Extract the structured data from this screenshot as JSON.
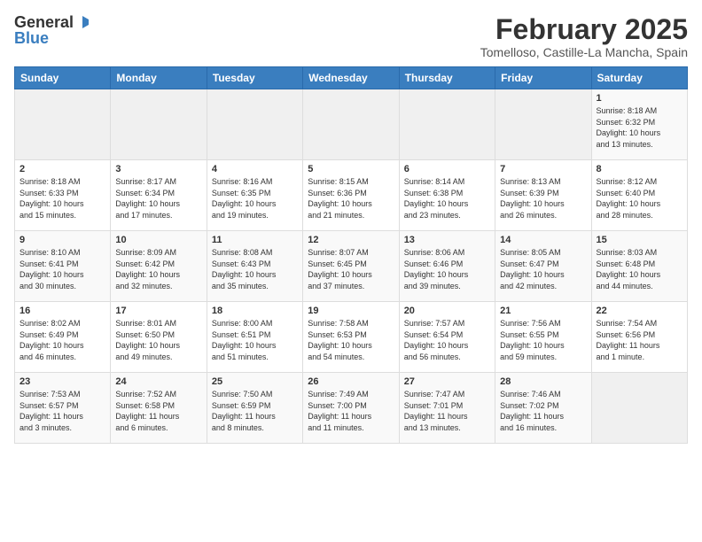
{
  "header": {
    "logo_general": "General",
    "logo_blue": "Blue",
    "month_title": "February 2025",
    "location": "Tomelloso, Castille-La Mancha, Spain"
  },
  "weekdays": [
    "Sunday",
    "Monday",
    "Tuesday",
    "Wednesday",
    "Thursday",
    "Friday",
    "Saturday"
  ],
  "weeks": [
    [
      {
        "day": "",
        "info": ""
      },
      {
        "day": "",
        "info": ""
      },
      {
        "day": "",
        "info": ""
      },
      {
        "day": "",
        "info": ""
      },
      {
        "day": "",
        "info": ""
      },
      {
        "day": "",
        "info": ""
      },
      {
        "day": "1",
        "info": "Sunrise: 8:18 AM\nSunset: 6:32 PM\nDaylight: 10 hours\nand 13 minutes."
      }
    ],
    [
      {
        "day": "2",
        "info": "Sunrise: 8:18 AM\nSunset: 6:33 PM\nDaylight: 10 hours\nand 15 minutes."
      },
      {
        "day": "3",
        "info": "Sunrise: 8:17 AM\nSunset: 6:34 PM\nDaylight: 10 hours\nand 17 minutes."
      },
      {
        "day": "4",
        "info": "Sunrise: 8:16 AM\nSunset: 6:35 PM\nDaylight: 10 hours\nand 19 minutes."
      },
      {
        "day": "5",
        "info": "Sunrise: 8:15 AM\nSunset: 6:36 PM\nDaylight: 10 hours\nand 21 minutes."
      },
      {
        "day": "6",
        "info": "Sunrise: 8:14 AM\nSunset: 6:38 PM\nDaylight: 10 hours\nand 23 minutes."
      },
      {
        "day": "7",
        "info": "Sunrise: 8:13 AM\nSunset: 6:39 PM\nDaylight: 10 hours\nand 26 minutes."
      },
      {
        "day": "8",
        "info": "Sunrise: 8:12 AM\nSunset: 6:40 PM\nDaylight: 10 hours\nand 28 minutes."
      }
    ],
    [
      {
        "day": "9",
        "info": "Sunrise: 8:10 AM\nSunset: 6:41 PM\nDaylight: 10 hours\nand 30 minutes."
      },
      {
        "day": "10",
        "info": "Sunrise: 8:09 AM\nSunset: 6:42 PM\nDaylight: 10 hours\nand 32 minutes."
      },
      {
        "day": "11",
        "info": "Sunrise: 8:08 AM\nSunset: 6:43 PM\nDaylight: 10 hours\nand 35 minutes."
      },
      {
        "day": "12",
        "info": "Sunrise: 8:07 AM\nSunset: 6:45 PM\nDaylight: 10 hours\nand 37 minutes."
      },
      {
        "day": "13",
        "info": "Sunrise: 8:06 AM\nSunset: 6:46 PM\nDaylight: 10 hours\nand 39 minutes."
      },
      {
        "day": "14",
        "info": "Sunrise: 8:05 AM\nSunset: 6:47 PM\nDaylight: 10 hours\nand 42 minutes."
      },
      {
        "day": "15",
        "info": "Sunrise: 8:03 AM\nSunset: 6:48 PM\nDaylight: 10 hours\nand 44 minutes."
      }
    ],
    [
      {
        "day": "16",
        "info": "Sunrise: 8:02 AM\nSunset: 6:49 PM\nDaylight: 10 hours\nand 46 minutes."
      },
      {
        "day": "17",
        "info": "Sunrise: 8:01 AM\nSunset: 6:50 PM\nDaylight: 10 hours\nand 49 minutes."
      },
      {
        "day": "18",
        "info": "Sunrise: 8:00 AM\nSunset: 6:51 PM\nDaylight: 10 hours\nand 51 minutes."
      },
      {
        "day": "19",
        "info": "Sunrise: 7:58 AM\nSunset: 6:53 PM\nDaylight: 10 hours\nand 54 minutes."
      },
      {
        "day": "20",
        "info": "Sunrise: 7:57 AM\nSunset: 6:54 PM\nDaylight: 10 hours\nand 56 minutes."
      },
      {
        "day": "21",
        "info": "Sunrise: 7:56 AM\nSunset: 6:55 PM\nDaylight: 10 hours\nand 59 minutes."
      },
      {
        "day": "22",
        "info": "Sunrise: 7:54 AM\nSunset: 6:56 PM\nDaylight: 11 hours\nand 1 minute."
      }
    ],
    [
      {
        "day": "23",
        "info": "Sunrise: 7:53 AM\nSunset: 6:57 PM\nDaylight: 11 hours\nand 3 minutes."
      },
      {
        "day": "24",
        "info": "Sunrise: 7:52 AM\nSunset: 6:58 PM\nDaylight: 11 hours\nand 6 minutes."
      },
      {
        "day": "25",
        "info": "Sunrise: 7:50 AM\nSunset: 6:59 PM\nDaylight: 11 hours\nand 8 minutes."
      },
      {
        "day": "26",
        "info": "Sunrise: 7:49 AM\nSunset: 7:00 PM\nDaylight: 11 hours\nand 11 minutes."
      },
      {
        "day": "27",
        "info": "Sunrise: 7:47 AM\nSunset: 7:01 PM\nDaylight: 11 hours\nand 13 minutes."
      },
      {
        "day": "28",
        "info": "Sunrise: 7:46 AM\nSunset: 7:02 PM\nDaylight: 11 hours\nand 16 minutes."
      },
      {
        "day": "",
        "info": ""
      }
    ]
  ]
}
